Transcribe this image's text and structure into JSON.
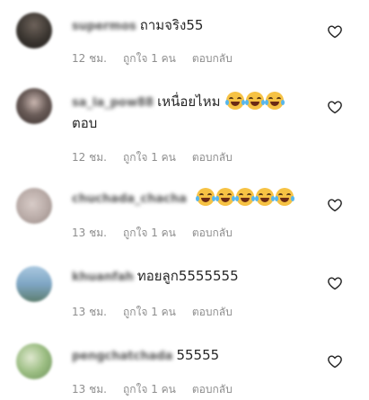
{
  "comments": [
    {
      "username": "supermos",
      "text": "ถามจริง55",
      "emoji_count": 0,
      "text2": "",
      "time": "12 ชม.",
      "likes": "ถูกใจ 1 คน",
      "reply": "ตอบกลับ",
      "avatar_color": "#3a3530"
    },
    {
      "username": "sa_la_pow88",
      "text": "เหนื่อยไหม",
      "emoji_count": 3,
      "text2": "ตอบ",
      "time": "12 ชม.",
      "likes": "ถูกใจ 1 คน",
      "reply": "ตอบกลับ",
      "avatar_color": "#6a5c58"
    },
    {
      "username": "chuchada_chacha",
      "text": "",
      "emoji_count": 5,
      "text2": "",
      "time": "13 ชม.",
      "likes": "ถูกใจ 1 คน",
      "reply": "ตอบกลับ",
      "avatar_color": "#b8aaa6"
    },
    {
      "username": "khuanfah",
      "text": "ทอยลูก5555555",
      "emoji_count": 0,
      "text2": "",
      "time": "13 ชม.",
      "likes": "ถูกใจ 1 คน",
      "reply": "ตอบกลับ",
      "avatar_color": "#7fa6c4"
    },
    {
      "username": "pengchatchada",
      "text": "55555",
      "emoji_count": 0,
      "text2": "",
      "time": "13 ชม.",
      "likes": "ถูกใจ 1 คน",
      "reply": "ตอบกลับ",
      "avatar_color": "#9bbd82"
    }
  ],
  "icons": {
    "like": "heart-outline-icon",
    "emoji": "laughing-tears-emoji"
  }
}
